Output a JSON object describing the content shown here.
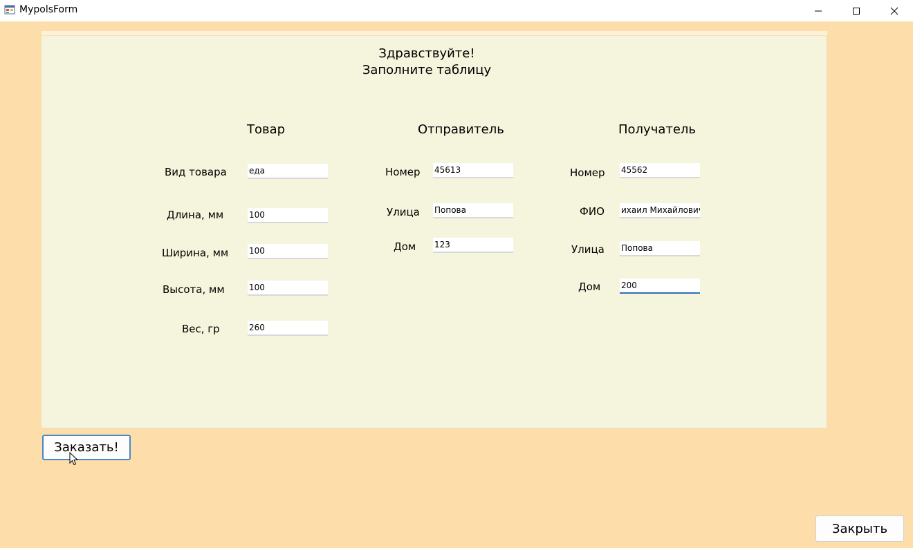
{
  "window": {
    "title": "MypolsForm"
  },
  "greeting": {
    "line1": "Здравствуйте!",
    "line2": "Заполните таблицу"
  },
  "goods": {
    "heading": "Товар",
    "fields": [
      {
        "label": "Вид товара",
        "value": "еда"
      },
      {
        "label": "Длина, мм",
        "value": "100"
      },
      {
        "label": "Ширина, мм",
        "value": "100"
      },
      {
        "label": "Высота, мм",
        "value": "100"
      },
      {
        "label": "Вес, гр",
        "value": "260"
      }
    ]
  },
  "sender": {
    "heading": "Отправитель",
    "fields": [
      {
        "label": "Номер",
        "value": "45613"
      },
      {
        "label": "Улица",
        "value": "Попова"
      },
      {
        "label": "Дом",
        "value": "123"
      }
    ]
  },
  "recipient": {
    "heading": "Получатель",
    "fields": [
      {
        "label": "Номер",
        "value": "45562"
      },
      {
        "label": "ФИО",
        "value": "ихаил Михайлович"
      },
      {
        "label": "Улица",
        "value": "Попова"
      },
      {
        "label": "Дом",
        "value": "200"
      }
    ]
  },
  "buttons": {
    "order": "Заказать!",
    "close": "Закрыть"
  },
  "icons": {
    "app": "winforms-app-icon",
    "minimize": "minimize-icon",
    "maximize": "maximize-icon",
    "close": "close-icon",
    "cursor": "mouse-cursor-icon"
  },
  "colors": {
    "form_background": "#fddeaa",
    "panel_background": "#f5f4dc",
    "focus_accent": "#2b6fb6"
  }
}
